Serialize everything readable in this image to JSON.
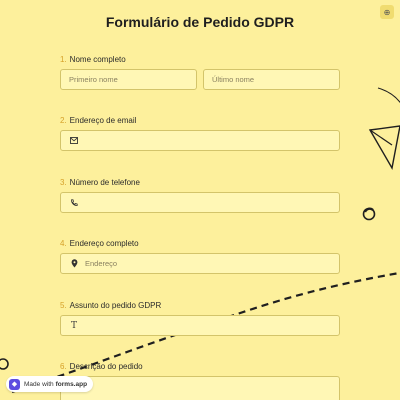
{
  "form": {
    "title": "Formulário de Pedido GDPR"
  },
  "corner_button": {
    "icon": "translate-icon"
  },
  "questions": [
    {
      "number": "1.",
      "label": "Nome completo",
      "inputs": [
        {
          "placeholder": "Primeiro nome"
        },
        {
          "placeholder": "Último nome"
        }
      ]
    },
    {
      "number": "2.",
      "label": "Endereço de email",
      "icon": "envelope-icon",
      "placeholder": ""
    },
    {
      "number": "3.",
      "label": "Número de telefone",
      "icon": "phone-icon",
      "placeholder": ""
    },
    {
      "number": "4.",
      "label": "Endereço completo",
      "icon": "location-pin-icon",
      "placeholder": "Endereço"
    },
    {
      "number": "5.",
      "label": "Assunto do pedido GDPR",
      "icon": "text-t-icon",
      "placeholder": ""
    },
    {
      "number": "6.",
      "label": "Descrição do pedido",
      "placeholder": ""
    }
  ],
  "badge": {
    "prefix": "Made with",
    "brand": "forms.app"
  },
  "colors": {
    "background": "#fdf09c",
    "field": "#fff7b5",
    "accent_number": "#d6a12a",
    "badge_logo": "#5d4de0"
  }
}
